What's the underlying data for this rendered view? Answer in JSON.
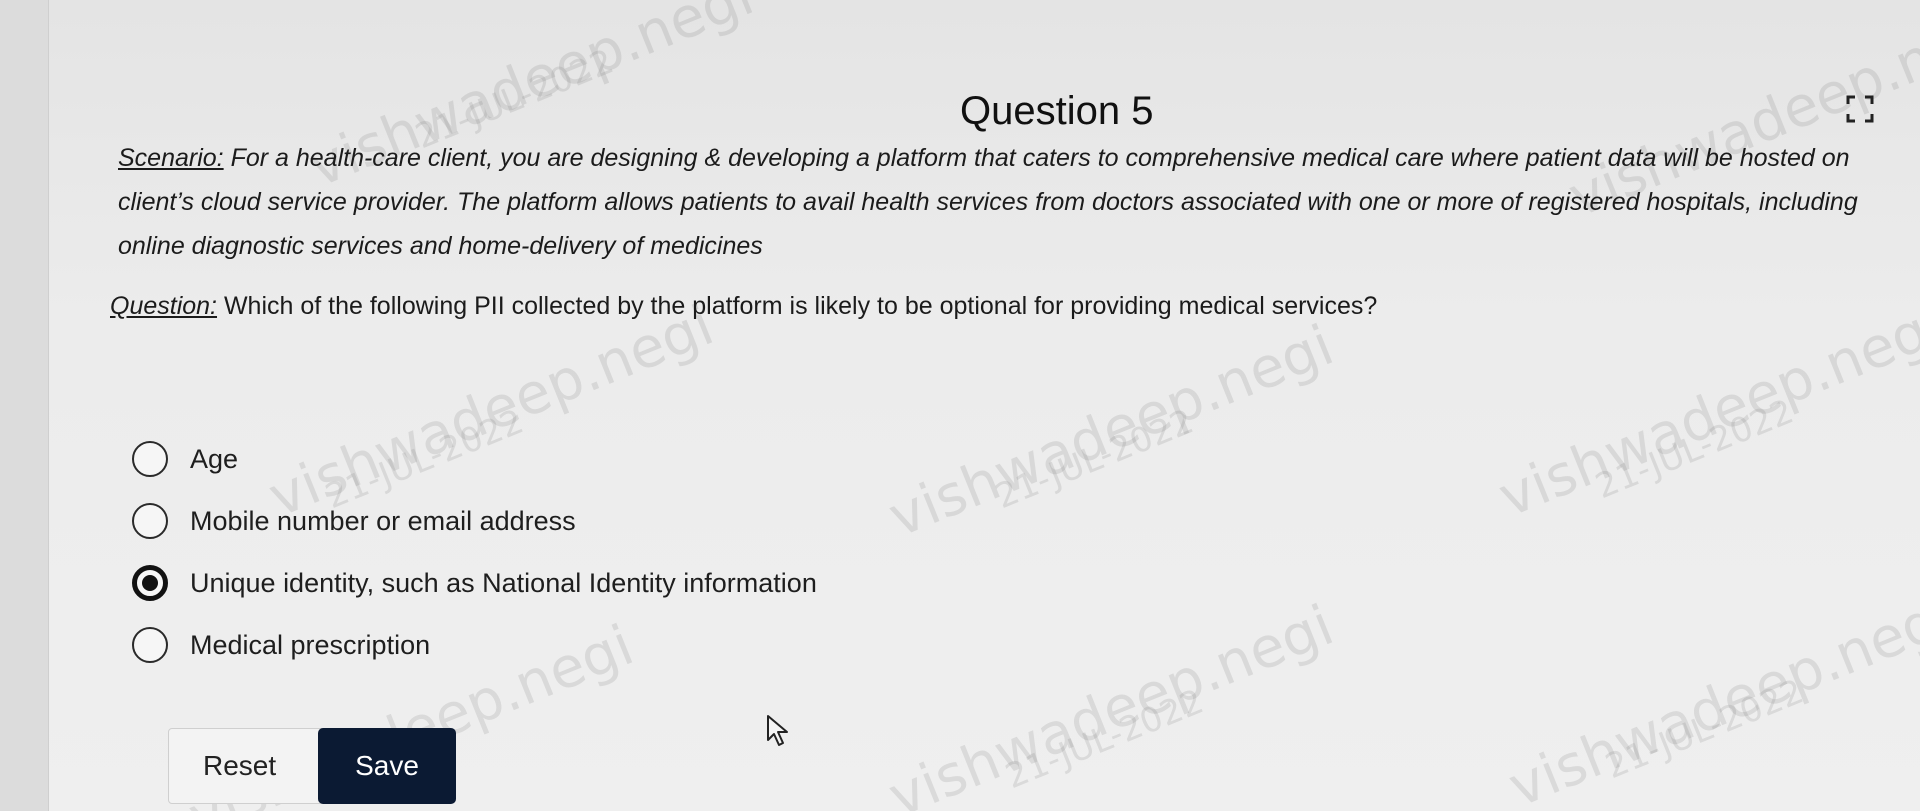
{
  "question": {
    "heading": "Question 5",
    "scenario_label": "Scenario:",
    "scenario_text": " For a health-care client, you are designing & developing a platform that caters to comprehensive medical care where patient data will be hosted on client’s cloud service provider. The platform allows patients to avail health services from doctors associated with one or more of registered hospitals, including online diagnostic services and home-delivery of medicines",
    "question_label": "Question:",
    "question_text": " Which of the following PII collected by the platform is likely to be optional for providing medical services?"
  },
  "options": [
    {
      "label": "Age",
      "selected": false
    },
    {
      "label": "Mobile number or email address",
      "selected": false
    },
    {
      "label": "Unique identity, such as National Identity information",
      "selected": true
    },
    {
      "label": "Medical prescription",
      "selected": false
    }
  ],
  "buttons": {
    "reset_label": "Reset",
    "save_label": "Save"
  },
  "icons": {
    "expand": "expand-icon",
    "cursor": "mouse-pointer-icon"
  },
  "colors": {
    "save_button": "#0b1a33",
    "background": "#ececec"
  }
}
